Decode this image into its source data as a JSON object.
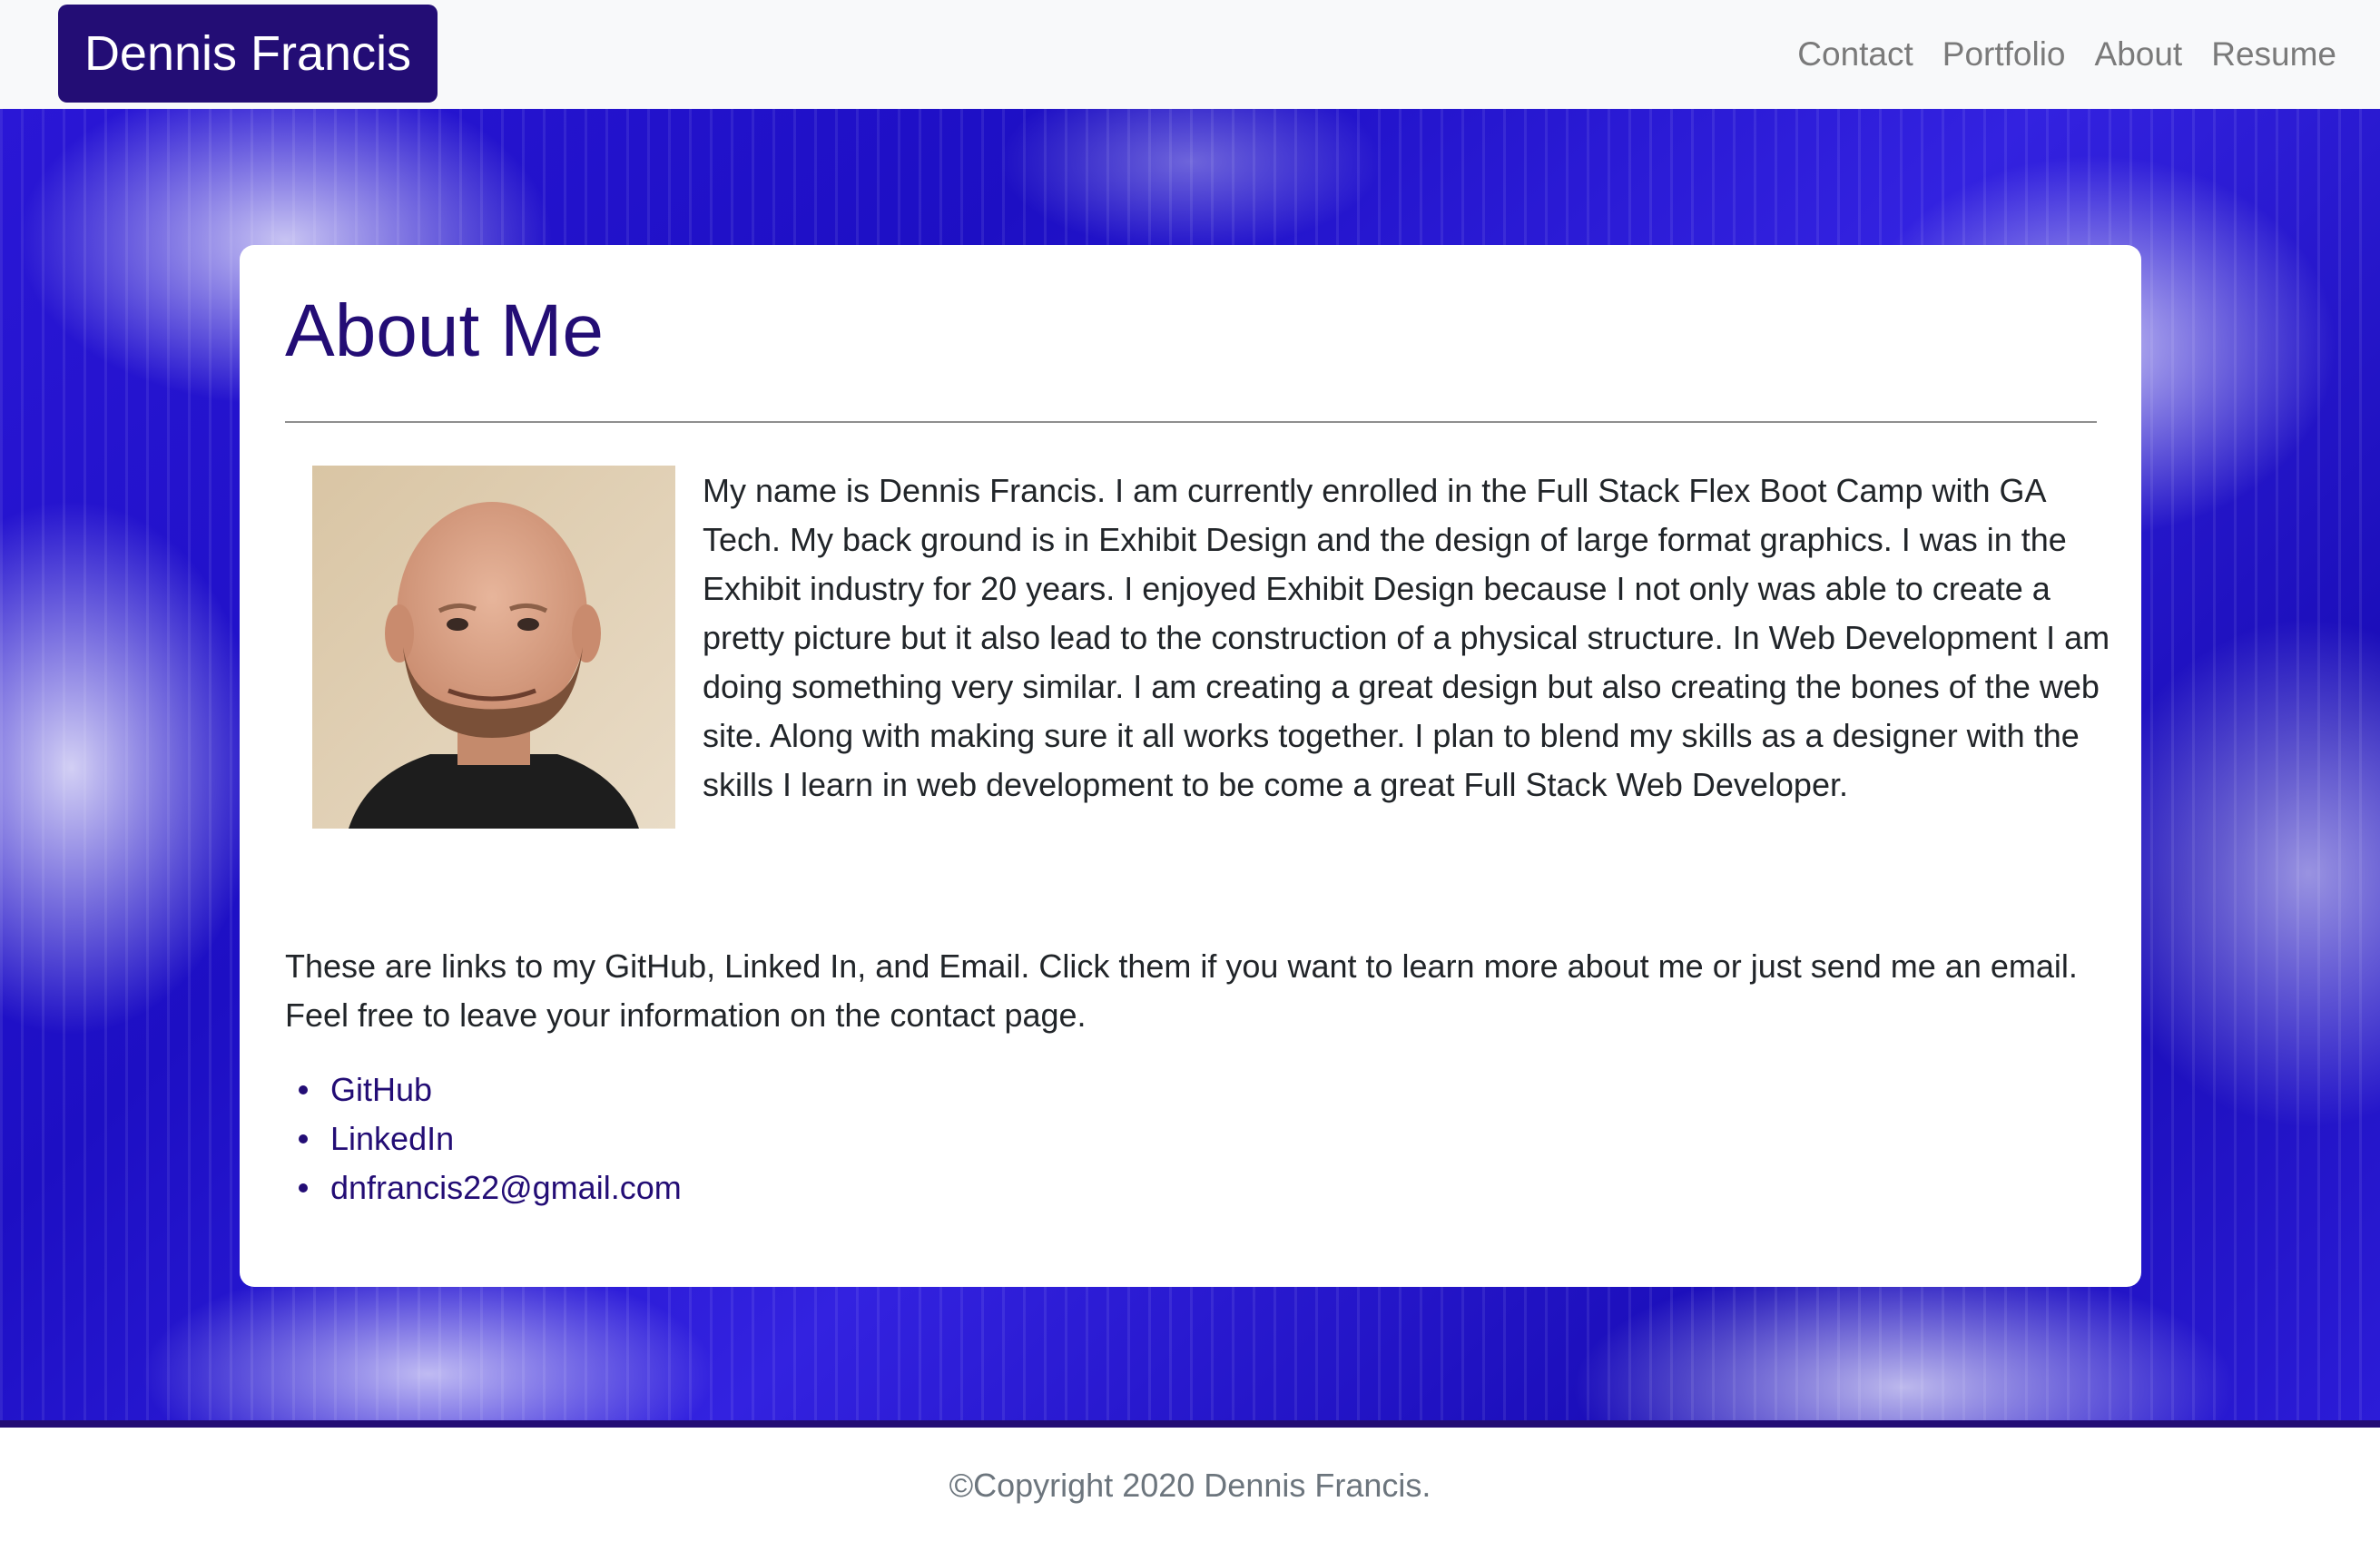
{
  "navbar": {
    "brand": "Dennis Francis",
    "links": [
      "Contact",
      "Portfolio",
      "About",
      "Resume"
    ]
  },
  "about": {
    "title": "About Me",
    "bio": "My name is Dennis Francis. I am currently enrolled in the Full Stack Flex Boot Camp with GA Tech. My back ground is in Exhibit Design and the design of large format graphics. I was in the Exhibit industry for 20 years. I enjoyed Exhibit Design because I not only was able to create a pretty picture but it also lead to the construction of a physical structure. In Web Development I am doing something very similar. I am creating a great design but also creating the bones of the web site. Along with making sure it all works together. I plan to blend my skills as a designer with the skills I learn in web development to be come a great Full Stack Web Developer.",
    "links_intro": "These are links to my GitHub, Linked In, and Email. Click them if you want to learn more about me or just send me an email. Feel free to leave your information on the contact page.",
    "links": [
      "GitHub",
      "LinkedIn",
      "dnfrancis22@gmail.com"
    ]
  },
  "footer": {
    "copyright": "©Copyright 2020 Dennis Francis."
  },
  "colors": {
    "brand": "#230d75",
    "hero_blue": "#2a17d6",
    "nav_text": "#7a7a7a",
    "footer_text": "#6c757d"
  }
}
